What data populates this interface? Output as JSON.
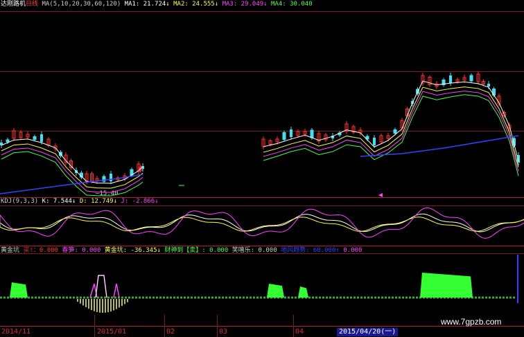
{
  "header": {
    "stock_name": "达刚路机",
    "period": "日线",
    "ma_params": "MA(5,10,20,30,60,120)",
    "ma1": "MA1: 21.724↓",
    "ma2": "MA2: 24.555↓",
    "ma3": "MA3: 29.049↓",
    "ma4": "MA4: 30.040"
  },
  "price_panel": {
    "low_label": "15.40",
    "colors": {
      "up": "#ff3030",
      "down": "#40e0f0",
      "ma5": "#ffffff",
      "ma10": "#ffff44",
      "ma20": "#ff44ff",
      "ma30": "#44ff44",
      "ma60": "#3344ff"
    }
  },
  "kdj": {
    "title": "KDJ(9,3,3)",
    "k": "K: 7.544↓",
    "d": "D: 12.749↓",
    "j": "J: -2.866↓"
  },
  "indicator": {
    "name": "黄金坑",
    "buy": "买!：0.000",
    "spring": "春笋: 0.000",
    "pit": "黄金坑: -36.345↓",
    "wealth": "财神到【卖】: 0.000",
    "happy": "笑嘻乐: 0.000",
    "blurred": "地风趋势: 60.000↑",
    "last": "0.000"
  },
  "dates": [
    "2014/11",
    "2015/01",
    "02",
    "03",
    "04",
    "2015/04/20(一)"
  ],
  "watermark": "www.7gpzb.com",
  "chart_data": {
    "type": "candlestick",
    "title": "达刚路机 日线",
    "ma_values": {
      "MA1": 21.724,
      "MA2": 24.555,
      "MA3": 29.049,
      "MA4": 30.04
    },
    "kdj_values": {
      "K": 7.544,
      "D": 12.749,
      "J": -2.866
    },
    "annotated_low": 15.4,
    "x_ticks": [
      "2014/11",
      "2015/01",
      "02",
      "03",
      "04",
      "2015/04/20(一)"
    ]
  }
}
